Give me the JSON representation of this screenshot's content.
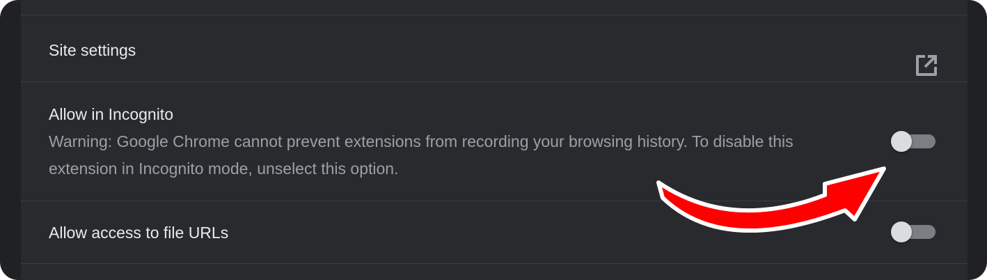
{
  "rows": [
    {
      "title": "Site settings",
      "action_icon": "open-in-new-icon"
    },
    {
      "title": "Allow in Incognito",
      "description": "Warning: Google Chrome cannot prevent extensions from recording your browsing history. To disable this extension in Incognito mode, unselect this option.",
      "enabled": false
    },
    {
      "title": "Allow access to file URLs",
      "enabled": false
    }
  ],
  "annotation": {
    "arrow_color": "#ff0000",
    "arrow_outline": "#ffffff"
  },
  "colors": {
    "background": "#202124",
    "panel": "#292a2d",
    "title_text": "#e8eaed",
    "description_text": "#9aa0a6",
    "toggle_track_off": "#7b7e83",
    "toggle_knob_off": "#dadce0"
  }
}
